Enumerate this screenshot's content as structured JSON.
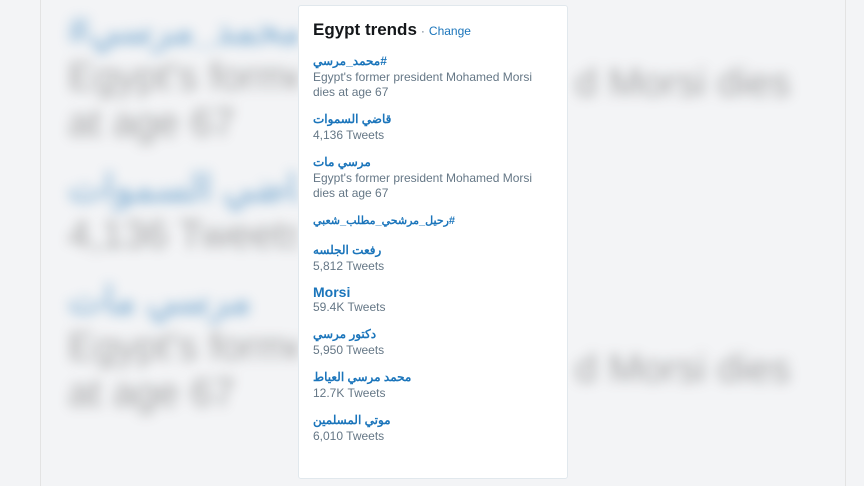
{
  "background": {
    "left": [
      {
        "name": "#محمد_مرسي",
        "meta": "Egypt's former president Mohamed Morsi dies at age 67"
      },
      {
        "name": "قاضي السموات",
        "meta": "4,136 Tweets"
      },
      {
        "name": "مرسي مات",
        "meta": "Egypt's former president Mohamed Morsi dies at age 67"
      }
    ]
  },
  "card": {
    "title": "Egypt trends",
    "separator": "·",
    "change_label": "Change",
    "trends": [
      {
        "name": "#محمد_مرسي",
        "meta": "Egypt's former president Mohamed Morsi dies at age 67"
      },
      {
        "name": "قاضي السموات",
        "meta": "4,136 Tweets"
      },
      {
        "name": "مرسي مات",
        "meta": "Egypt's former president Mohamed Morsi dies at age 67"
      },
      {
        "name": "#رحيل_مرشحي_مطلب_شعبي",
        "meta": ""
      },
      {
        "name": "رفعت الجلسه",
        "meta": "5,812 Tweets"
      },
      {
        "name": "Morsi",
        "meta": "59.4K Tweets"
      },
      {
        "name": "دكتور مرسي",
        "meta": "5,950 Tweets"
      },
      {
        "name": "محمد مرسي العياط",
        "meta": "12.7K Tweets"
      },
      {
        "name": "موتي المسلمين",
        "meta": "6,010 Tweets"
      }
    ]
  },
  "colors": {
    "link": "#1b75bb",
    "meta": "#657786",
    "title": "#14171a"
  }
}
